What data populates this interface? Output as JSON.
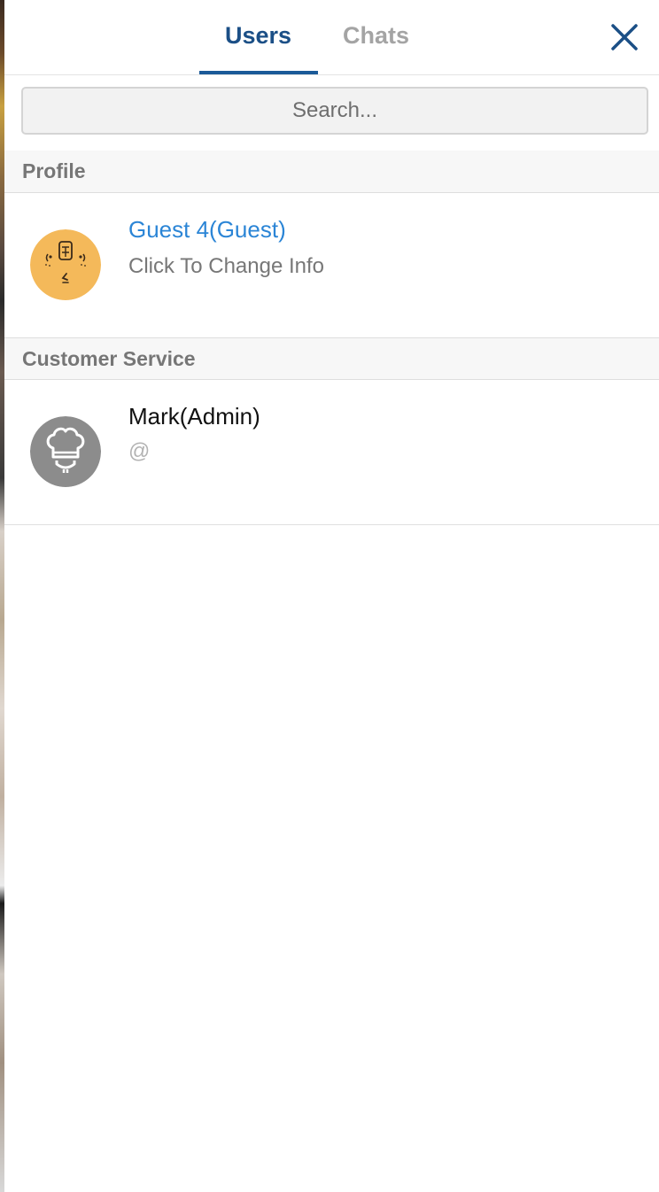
{
  "tabs": [
    {
      "label": "Users",
      "active": true
    },
    {
      "label": "Chats",
      "active": false
    }
  ],
  "close_icon": "close-x-icon",
  "search": {
    "placeholder": "Search...",
    "value": ""
  },
  "sections": {
    "profile": {
      "title": "Profile",
      "user": {
        "name": "Guest 4(Guest)",
        "subtitle": "Click To Change Info",
        "avatar_icon": "guest-face-avatar-icon",
        "avatar_color": "#f4b95a"
      }
    },
    "customer_service": {
      "title": "Customer Service",
      "user": {
        "name": "Mark(Admin)",
        "subtitle": "@",
        "avatar_icon": "chef-hat-avatar-icon",
        "avatar_color": "#8c8c8c"
      }
    }
  },
  "colors": {
    "accent": "#1b4f86",
    "link_blue": "#2b85d6",
    "muted": "#a4a4a4"
  }
}
